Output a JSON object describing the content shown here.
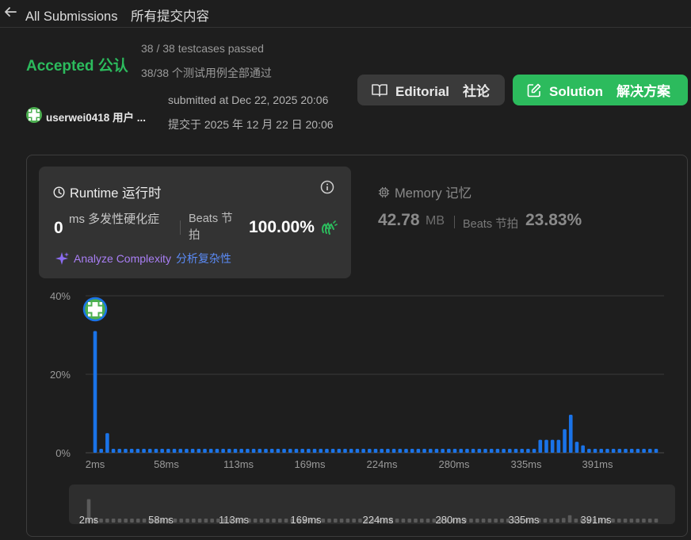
{
  "header": {
    "title": "All Submissions　所有提交内容"
  },
  "status": {
    "text": "Accepted  公认",
    "testcases_en": "38 / 38 testcases passed",
    "testcases_cn": "38/38 个测试用例全部通过"
  },
  "user": {
    "name": "userwei0418  用户 ..."
  },
  "submitted": {
    "en": "submitted at Dec 22, 2025 20:06",
    "cn": "提交于 2025 年 12 月 22 日 20:06"
  },
  "buttons": {
    "editorial": "Editorial　社论",
    "solution": "Solution　解决方案"
  },
  "runtime": {
    "title": "Runtime  运行时",
    "value": "0",
    "unit": "ms  多发性硬化症",
    "beats": "Beats  节拍",
    "percent": "100.00%",
    "analyze_en": "Analyze Complexity",
    "analyze_cn": "分析复杂性"
  },
  "memory": {
    "title": "Memory  记忆",
    "value": "42.78",
    "unit": "MB",
    "beats": "Beats  节拍",
    "percent": "23.83%"
  },
  "colors": {
    "accent": "#2cbb5d",
    "bar": "#1a73e8",
    "bar_dim": "#5a5a5a"
  },
  "chart_data": {
    "type": "bar",
    "ylabel": "",
    "xlabel": "",
    "ylim": [
      0,
      40
    ],
    "y_ticks": [
      "0%",
      "20%",
      "40%"
    ],
    "x_ticks": [
      "2ms",
      "58ms",
      "113ms",
      "169ms",
      "224ms",
      "280ms",
      "335ms",
      "391ms"
    ],
    "minimap_ticks": [
      "2ms",
      "58ms",
      "113ms",
      "169ms",
      "224ms",
      "280ms",
      "335ms",
      "391ms"
    ],
    "values": [
      31,
      1,
      5,
      1,
      1,
      1,
      1,
      1,
      1,
      1,
      1,
      1,
      1,
      1,
      1,
      1,
      1,
      1,
      1,
      1,
      1,
      1,
      1,
      1,
      1,
      1,
      1,
      1,
      1,
      1,
      1,
      1,
      1,
      1,
      1,
      1,
      1,
      1,
      1,
      1,
      1,
      1,
      1,
      1,
      1,
      1,
      1,
      1,
      1,
      1,
      1,
      1,
      1,
      1,
      1,
      1,
      1,
      1,
      1,
      1,
      1,
      1,
      1,
      1,
      1,
      1,
      1,
      1,
      1,
      1,
      1,
      1,
      1,
      3.3,
      3.3,
      3.3,
      3.3,
      6,
      9.7,
      2.8,
      1.9,
      1,
      1,
      1,
      1,
      1,
      1,
      1,
      1,
      1,
      1,
      1,
      1
    ]
  }
}
